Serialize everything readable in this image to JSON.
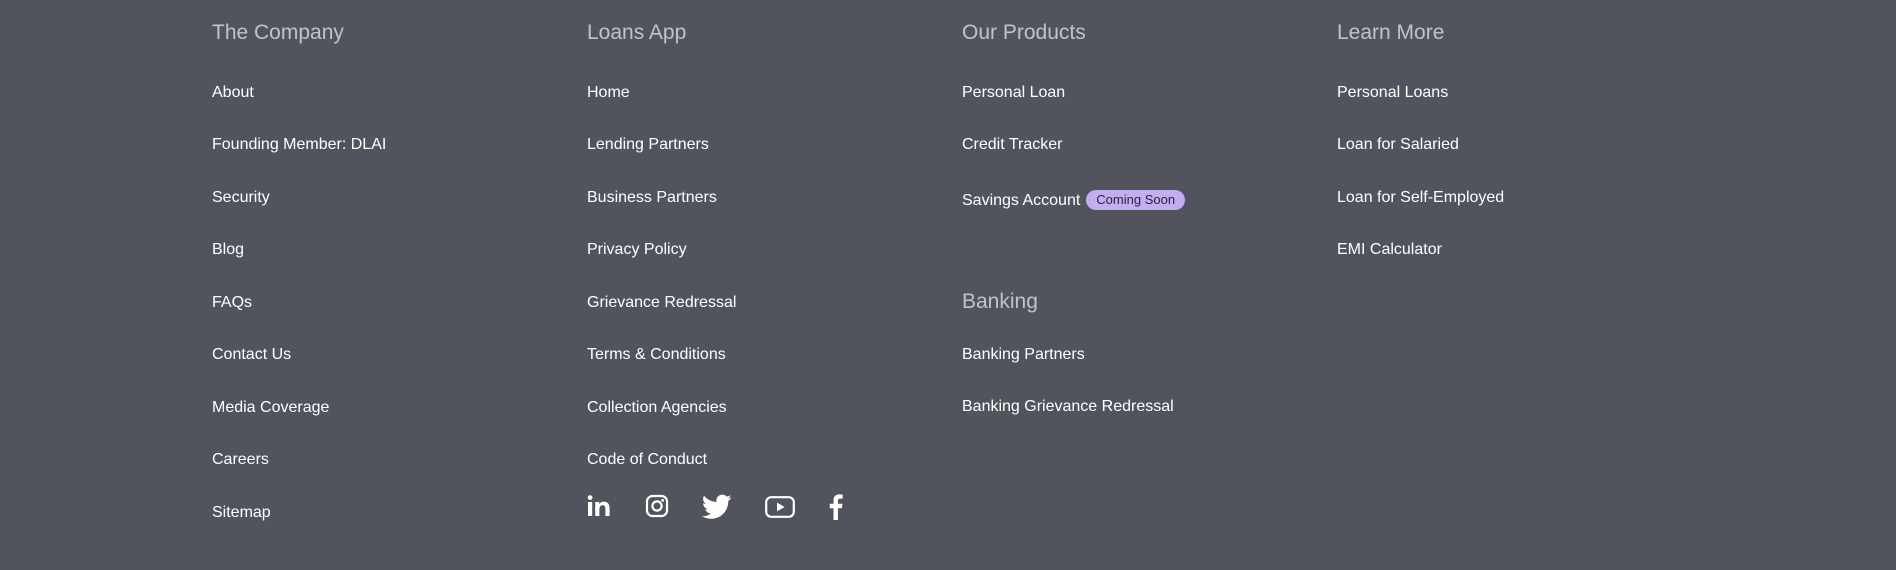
{
  "columns": {
    "company": {
      "heading": "The Company",
      "links": [
        "About",
        "Founding Member: DLAI",
        "Security",
        "Blog",
        "FAQs",
        "Contact Us",
        "Media Coverage",
        "Careers",
        "Sitemap"
      ]
    },
    "loans_app": {
      "heading": "Loans App",
      "links": [
        "Home",
        "Lending Partners",
        "Business Partners",
        "Privacy Policy",
        "Grievance Redressal",
        "Terms & Conditions",
        "Collection Agencies",
        "Code of Conduct"
      ]
    },
    "products": {
      "heading": "Our Products",
      "links": [
        "Personal Loan",
        "Credit Tracker",
        "Savings Account"
      ],
      "badge": "Coming Soon"
    },
    "banking": {
      "heading": "Banking",
      "links": [
        "Banking Partners",
        "Banking Grievance Redressal"
      ]
    },
    "learn_more": {
      "heading": "Learn More",
      "links": [
        "Personal Loans",
        "Loan for Salaried",
        "Loan for Self-Employed",
        "EMI Calculator"
      ]
    }
  },
  "socials": [
    "linkedin-icon",
    "instagram-icon",
    "twitter-icon",
    "youtube-icon",
    "facebook-icon"
  ],
  "colors": {
    "background": "#52545d",
    "heading": "#c2c3c9",
    "link": "#ffffff",
    "badge_bg": "#c3aef0",
    "badge_text": "#2b2244"
  }
}
